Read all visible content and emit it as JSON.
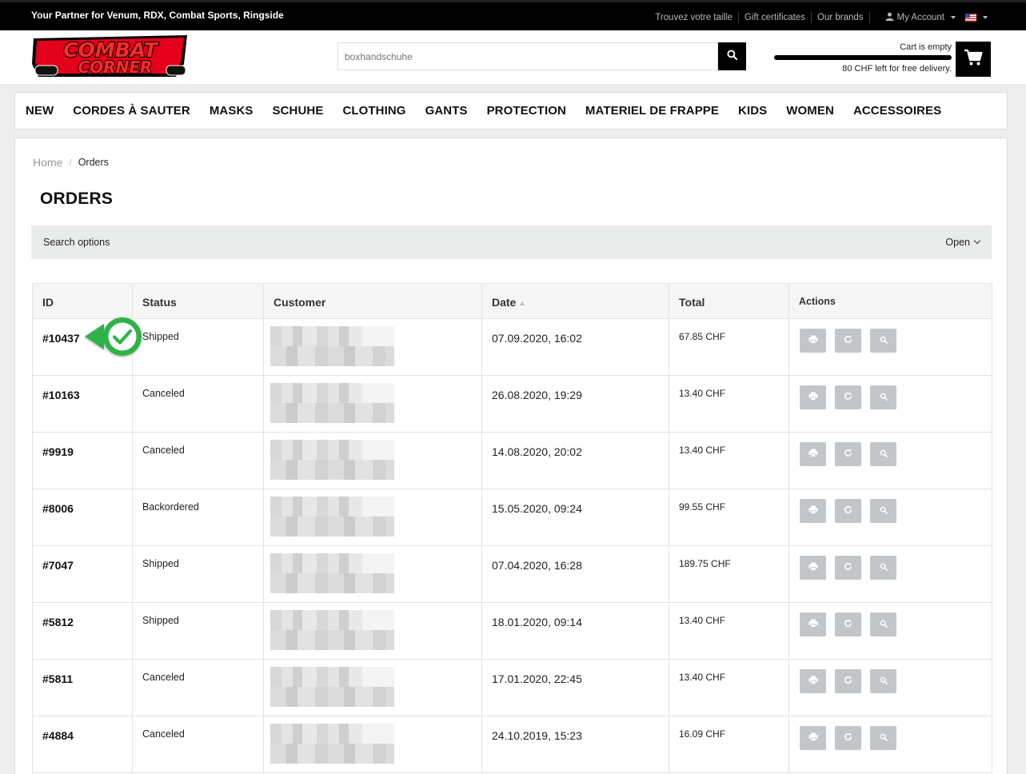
{
  "topbar": {
    "tagline": "Your Partner for Venum, RDX, Combat Sports, Ringside",
    "links": [
      "Trouvez votre taille",
      "Gift certificates",
      "Our brands"
    ],
    "account_label": "My Account"
  },
  "header": {
    "logo_text": [
      "COMBAT",
      "CORNER"
    ],
    "search_placeholder": "boxhandschuhe",
    "cart_status": "Cart is empty",
    "cart_free_delivery": "80 CHF left for free delivery."
  },
  "nav": {
    "items": [
      "NEW",
      "CORDES À SAUTER",
      "MASKS",
      "SCHUHE",
      "CLOTHING",
      "GANTS",
      "PROTECTION",
      "MATERIEL DE FRAPPE",
      "KIDS",
      "WOMEN",
      "ACCESSOIRES"
    ]
  },
  "breadcrumb": {
    "home": "Home",
    "separator": "/",
    "current": "Orders"
  },
  "page_title": "ORDERS",
  "search_options": {
    "label": "Search options",
    "toggle": "Open"
  },
  "table": {
    "headers": {
      "id": "ID",
      "status": "Status",
      "customer": "Customer",
      "date": "Date",
      "total": "Total",
      "actions": "Actions"
    },
    "rows": [
      {
        "id": "#10437",
        "status": "Shipped",
        "date": "07.09.2020, 16:02",
        "total": "67.85 CHF"
      },
      {
        "id": "#10163",
        "status": "Canceled",
        "date": "26.08.2020, 19:29",
        "total": "13.40 CHF"
      },
      {
        "id": "#9919",
        "status": "Canceled",
        "date": "14.08.2020, 20:02",
        "total": "13.40 CHF"
      },
      {
        "id": "#8006",
        "status": "Backordered",
        "date": "15.05.2020, 09:24",
        "total": "99.55 CHF"
      },
      {
        "id": "#7047",
        "status": "Shipped",
        "date": "07.04.2020, 16:28",
        "total": "189.75 CHF"
      },
      {
        "id": "#5812",
        "status": "Shipped",
        "date": "18.01.2020, 09:14",
        "total": "13.40 CHF"
      },
      {
        "id": "#5811",
        "status": "Canceled",
        "date": "17.01.2020, 22:45",
        "total": "13.40 CHF"
      },
      {
        "id": "#4884",
        "status": "Canceled",
        "date": "24.10.2019, 15:23",
        "total": "16.09 CHF"
      }
    ]
  },
  "icons": {
    "actions": [
      "print-icon",
      "reorder-icon",
      "view-icon"
    ],
    "check": "check-icon"
  },
  "colors": {
    "accent_red": "#e3001b",
    "check_green": "#2db34a",
    "action_gray": "#c2c6c9"
  }
}
